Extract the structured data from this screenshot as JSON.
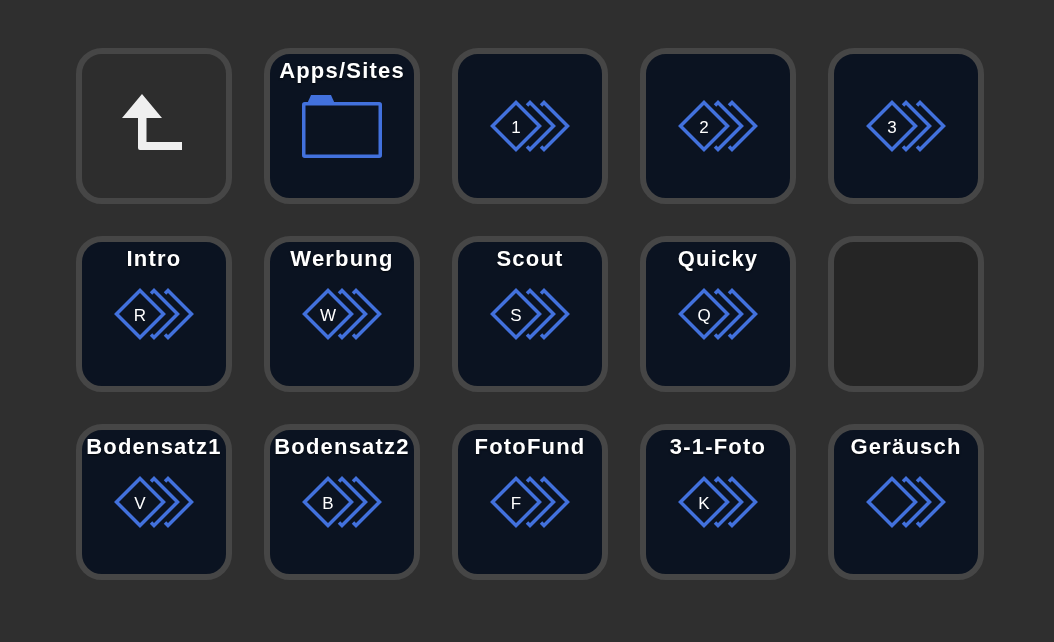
{
  "rows": [
    {
      "keys": [
        {
          "kind": "back"
        },
        {
          "kind": "folder",
          "title": "Apps/Sites"
        },
        {
          "kind": "action",
          "letter": "1"
        },
        {
          "kind": "action",
          "letter": "2"
        },
        {
          "kind": "action",
          "letter": "3"
        }
      ]
    },
    {
      "keys": [
        {
          "kind": "action",
          "title": "Intro",
          "letter": "R"
        },
        {
          "kind": "action",
          "title": "Werbung",
          "letter": "W"
        },
        {
          "kind": "action",
          "title": "Scout",
          "letter": "S"
        },
        {
          "kind": "action",
          "title": "Quicky",
          "letter": "Q"
        },
        {
          "kind": "empty"
        }
      ]
    },
    {
      "keys": [
        {
          "kind": "action",
          "title": "Bodensatz1",
          "letter": "V"
        },
        {
          "kind": "action",
          "title": "Bodensatz2",
          "letter": "B"
        },
        {
          "kind": "action",
          "title": "FotoFund",
          "letter": "F"
        },
        {
          "kind": "action",
          "title": "3-1-Foto",
          "letter": "K"
        },
        {
          "kind": "action",
          "title": "Geräusch"
        }
      ]
    }
  ]
}
